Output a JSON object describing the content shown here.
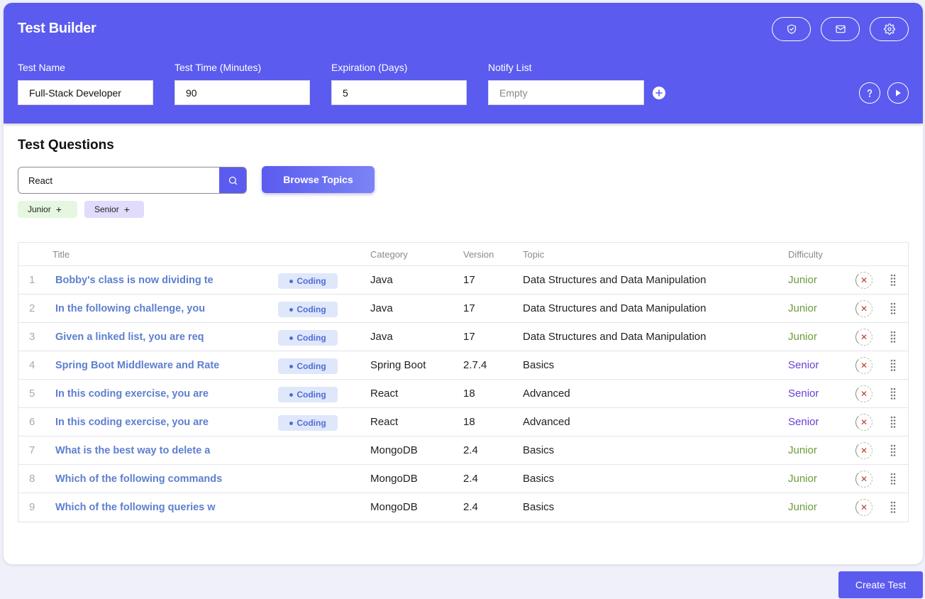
{
  "app": {
    "title": "Test Builder"
  },
  "header": {
    "fields": {
      "test_name": {
        "label": "Test Name",
        "value": "Full-Stack Developer"
      },
      "test_time": {
        "label": "Test Time (Minutes)",
        "value": "90"
      },
      "expiration": {
        "label": "Expiration (Days)",
        "value": "5"
      },
      "notify": {
        "label": "Notify List",
        "value": "",
        "placeholder": "Empty"
      }
    },
    "icons": [
      "shield-icon",
      "mail-icon",
      "gear-icon",
      "help-icon",
      "play-icon"
    ]
  },
  "questions": {
    "title": "Test Questions",
    "search": {
      "value": "React",
      "placeholder": ""
    },
    "browse_label": "Browse Topics",
    "chips": [
      {
        "label": "Junior",
        "color": "#e6f7e1"
      },
      {
        "label": "Senior",
        "color": "#e0dcfb"
      }
    ],
    "columns": {
      "title": "Title",
      "category": "Category",
      "version": "Version",
      "topic": "Topic",
      "difficulty": "Difficulty"
    },
    "badge_label": "Coding",
    "rows": [
      {
        "num": "1",
        "title": "Bobby's class is now dividing te",
        "coding": true,
        "category": "Java",
        "version": "17",
        "topic": "Data Structures and Data Manipulation",
        "difficulty": "Junior"
      },
      {
        "num": "2",
        "title": "In the following challenge, you",
        "coding": true,
        "category": "Java",
        "version": "17",
        "topic": "Data Structures and Data Manipulation",
        "difficulty": "Junior"
      },
      {
        "num": "3",
        "title": "Given a linked list, you are req",
        "coding": true,
        "category": "Java",
        "version": "17",
        "topic": "Data Structures and Data Manipulation",
        "difficulty": "Junior"
      },
      {
        "num": "4",
        "title": "Spring Boot Middleware and Rate",
        "coding": true,
        "category": "Spring Boot",
        "version": "2.7.4",
        "topic": "Basics",
        "difficulty": "Senior"
      },
      {
        "num": "5",
        "title": "In this coding exercise, you are",
        "coding": true,
        "category": "React",
        "version": "18",
        "topic": "Advanced",
        "difficulty": "Senior"
      },
      {
        "num": "6",
        "title": "In this coding exercise, you are",
        "coding": true,
        "category": "React",
        "version": "18",
        "topic": "Advanced",
        "difficulty": "Senior"
      },
      {
        "num": "7",
        "title": "What is the best way to delete a",
        "coding": false,
        "category": "MongoDB",
        "version": "2.4",
        "topic": "Basics",
        "difficulty": "Junior"
      },
      {
        "num": "8",
        "title": "Which of the following commands",
        "coding": false,
        "category": "MongoDB",
        "version": "2.4",
        "topic": "Basics",
        "difficulty": "Junior"
      },
      {
        "num": "9",
        "title": "Which of the following queries w",
        "coding": false,
        "category": "MongoDB",
        "version": "2.4",
        "topic": "Basics",
        "difficulty": "Junior"
      }
    ]
  },
  "footer": {
    "create_label": "Create Test"
  },
  "colors": {
    "accent": "#5b5bef",
    "junior": "#6b9b3a",
    "senior": "#6a3fd1",
    "link": "#5d7fcf"
  }
}
